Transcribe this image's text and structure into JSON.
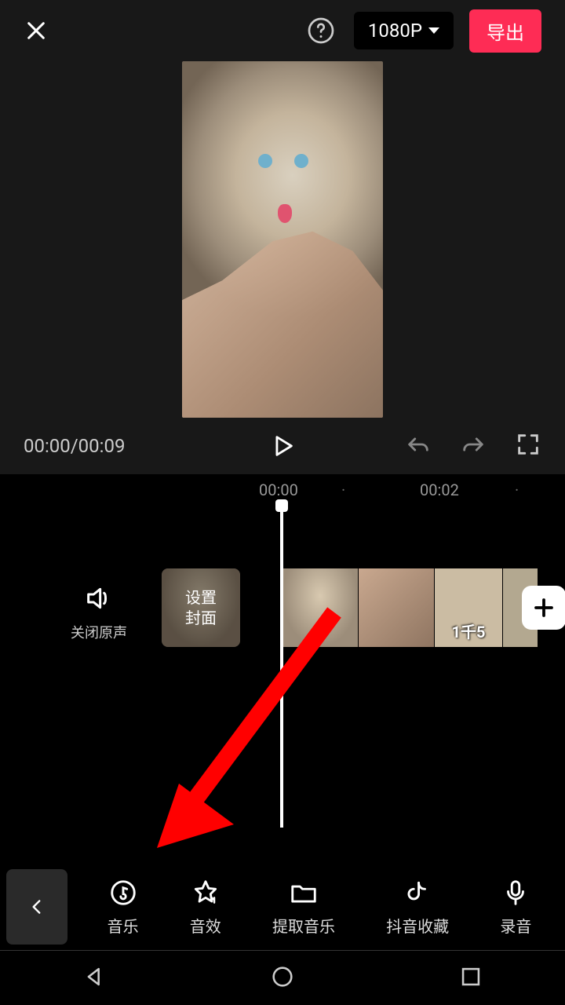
{
  "topbar": {
    "resolution": "1080P",
    "export_label": "导出"
  },
  "preview": {
    "time_display": "00:00/00:09"
  },
  "timeline": {
    "ticks": [
      {
        "pos": 330,
        "label": "00:00"
      },
      {
        "pos": 435,
        "label": "·"
      },
      {
        "pos": 535,
        "label": "00:02"
      },
      {
        "pos": 656,
        "label": "·"
      }
    ],
    "mute_label": "关闭原声",
    "cover_label": "设置\n封面",
    "clip3_overlay": "1千5"
  },
  "toolbar": {
    "items": [
      {
        "label": "音乐",
        "icon": "music"
      },
      {
        "label": "音效",
        "icon": "star"
      },
      {
        "label": "提取音乐",
        "icon": "folder"
      },
      {
        "label": "抖音收藏",
        "icon": "douyin"
      },
      {
        "label": "录音",
        "icon": "mic"
      }
    ]
  }
}
